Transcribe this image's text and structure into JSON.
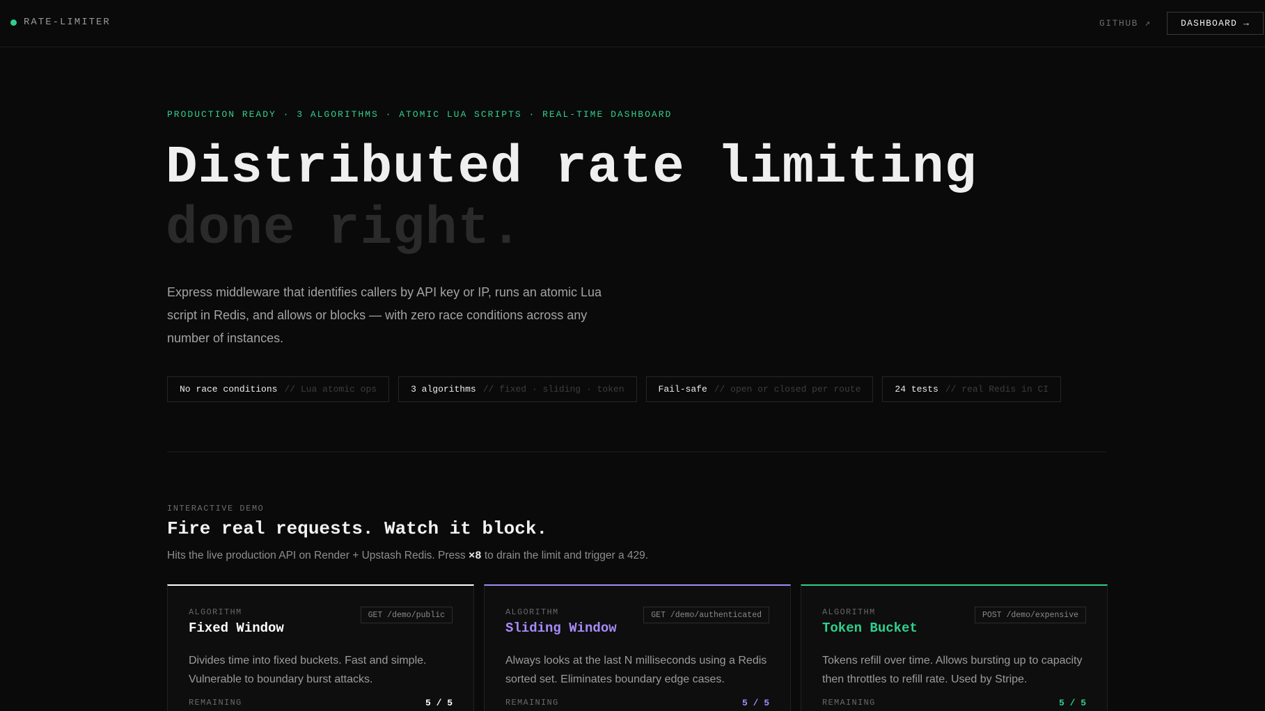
{
  "nav": {
    "brand": "RATE-LIMITER",
    "github": "GITHUB ↗",
    "dashboard": "DASHBOARD →"
  },
  "hero": {
    "eyebrow": "PRODUCTION READY · 3 ALGORITHMS · ATOMIC LUA SCRIPTS · REAL-TIME DASHBOARD",
    "title": "Distributed rate limiting",
    "subtitle": "done right.",
    "description": "Express middleware that identifies callers by API key or IP, runs an atomic Lua script in Redis, and allows or blocks — with zero race conditions across any number of instances."
  },
  "chips": [
    {
      "main": "No race conditions",
      "note": "// Lua atomic ops"
    },
    {
      "main": "3 algorithms",
      "note": "// fixed · sliding · token"
    },
    {
      "main": "Fail-safe",
      "note": "// open or closed per route"
    },
    {
      "main": "24 tests",
      "note": "// real Redis in CI"
    }
  ],
  "demo": {
    "label": "INTERACTIVE DEMO",
    "title": "Fire real requests. Watch it block.",
    "desc_before": "Hits the live production API on Render + Upstash Redis. Press ",
    "desc_key": "×8",
    "desc_after": " to drain the limit and trigger a 429."
  },
  "cards": [
    {
      "label": "ALGORITHM",
      "name": "Fixed Window",
      "route": "GET /demo/public",
      "desc": "Divides time into fixed buckets. Fast and simple. Vulnerable to boundary burst attacks.",
      "remaining_label": "REMAINING",
      "remaining": "5 / 5",
      "accent": "#ffffff"
    },
    {
      "label": "ALGORITHM",
      "name": "Sliding Window",
      "route": "GET /demo/authenticated",
      "desc": "Always looks at the last N milliseconds using a Redis sorted set. Eliminates boundary edge cases.",
      "remaining_label": "REMAINING",
      "remaining": "5 / 5",
      "accent": "#a78bfa"
    },
    {
      "label": "ALGORITHM",
      "name": "Token Bucket",
      "route": "POST /demo/expensive",
      "desc": "Tokens refill over time. Allows bursting up to capacity then throttles to refill rate. Used by Stripe.",
      "remaining_label": "REMAINING",
      "remaining": "5 / 5",
      "accent": "#2fd08e"
    }
  ]
}
